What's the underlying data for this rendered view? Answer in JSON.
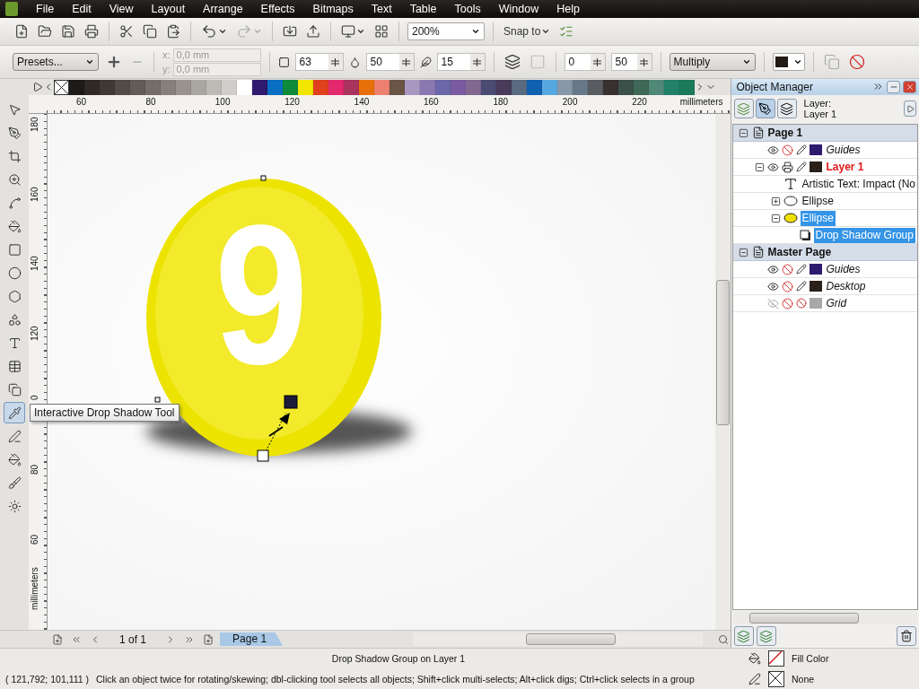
{
  "menu": [
    {
      "label": "File"
    },
    {
      "label": "Edit"
    },
    {
      "label": "View"
    },
    {
      "label": "Layout"
    },
    {
      "label": "Arrange"
    },
    {
      "label": "Effects"
    },
    {
      "label": "Bitmaps"
    },
    {
      "label": "Text"
    },
    {
      "label": "Table"
    },
    {
      "label": "Tools"
    },
    {
      "label": "Window"
    },
    {
      "label": "Help"
    }
  ],
  "toolbar": {
    "zoom": "200%",
    "snap": "Snap to"
  },
  "property_bar": {
    "presets": "Presets...",
    "x_label": "x:",
    "x_value": "0,0 mm",
    "y_label": "y:",
    "y_value": "0,0 mm",
    "opacity": "63",
    "feathering": "50",
    "feather_direction": "15",
    "fade": "0",
    "stretch": "50",
    "merge_mode": "Multiply"
  },
  "palette": [
    {
      "color": "#1e1a17"
    },
    {
      "color": "#2f2a26"
    },
    {
      "color": "#3f3935"
    },
    {
      "color": "#524b47"
    },
    {
      "color": "#625b57"
    },
    {
      "color": "#746e6a"
    },
    {
      "color": "#86807c"
    },
    {
      "color": "#98938f"
    },
    {
      "color": "#aaa6a2"
    },
    {
      "color": "#bdb9b5"
    },
    {
      "color": "#d0cdca"
    },
    {
      "color": "#ffffff"
    },
    {
      "color": "#2e1a6e"
    },
    {
      "color": "#0a6fc2"
    },
    {
      "color": "#0e8a3a"
    },
    {
      "color": "#f2e600"
    },
    {
      "color": "#e0401c"
    },
    {
      "color": "#e4286e"
    },
    {
      "color": "#a8335c"
    },
    {
      "color": "#e8700a"
    },
    {
      "color": "#ee8070"
    },
    {
      "color": "#6a5446"
    },
    {
      "color": "#a898c0"
    },
    {
      "color": "#8a78b0"
    },
    {
      "color": "#6a68a8"
    },
    {
      "color": "#7a5aa0"
    },
    {
      "color": "#806890"
    },
    {
      "color": "#4a4a72"
    },
    {
      "color": "#4a3a5a"
    },
    {
      "color": "#5a6a80"
    },
    {
      "color": "#1060b0"
    },
    {
      "color": "#58a8e0"
    },
    {
      "color": "#8898a8"
    },
    {
      "color": "#687888"
    },
    {
      "color": "#585c60"
    },
    {
      "color": "#383030"
    },
    {
      "color": "#3a5048"
    },
    {
      "color": "#406858"
    },
    {
      "color": "#508878"
    },
    {
      "color": "#208068"
    },
    {
      "color": "#1a7a5a"
    }
  ],
  "tools": [
    {
      "selected": false
    },
    {
      "selected": false
    },
    {
      "selected": false
    },
    {
      "selected": false
    },
    {
      "selected": false
    },
    {
      "selected": false
    },
    {
      "selected": false
    },
    {
      "selected": false
    },
    {
      "selected": false
    },
    {
      "selected": false
    },
    {
      "selected": false
    },
    {
      "selected": false
    },
    {
      "selected": false
    },
    {
      "selected": true
    },
    {
      "selected": false
    },
    {
      "selected": false
    },
    {
      "selected": false
    },
    {
      "selected": false
    }
  ],
  "tooltip": "Interactive Drop Shadow Tool",
  "ruler_top": {
    "labels": [
      "60",
      "80",
      "100",
      "120",
      "140",
      "160",
      "180",
      "200",
      "220"
    ],
    "unit": "millimeters"
  },
  "ruler_left": {
    "labels": [
      "180",
      "160",
      "140",
      "120",
      "0",
      "80",
      "60"
    ],
    "unit": "millimeters"
  },
  "canvas": {
    "digit": "9"
  },
  "page_nav": {
    "count": "1 of 1",
    "tab": "Page 1"
  },
  "object_manager": {
    "title": "Object Manager",
    "layer_label": "Layer:",
    "layer_name": "Layer 1",
    "tree": [
      {
        "kind": "page",
        "name": "Page 1",
        "expanded": true,
        "selected": false,
        "children": [
          {
            "kind": "layer",
            "name": "Guides",
            "special": true,
            "active": false,
            "visible": true,
            "printable": false,
            "editable": true,
            "color": "#2e1a6e",
            "selected": false
          },
          {
            "kind": "layer",
            "name": "Layer 1",
            "special": false,
            "active": true,
            "visible": true,
            "printable": true,
            "editable": true,
            "color": "#2a2018",
            "expanded": true,
            "selected": false,
            "children": [
              {
                "kind": "text",
                "name": "Artistic Text: Impact (No",
                "selected": false
              },
              {
                "kind": "ellipse",
                "name": "Ellipse",
                "filled": false,
                "expanded": false,
                "selected": false
              },
              {
                "kind": "ellipse",
                "name": "Ellipse",
                "filled": true,
                "expanded": true,
                "selected": true,
                "children": [
                  {
                    "kind": "shadow",
                    "name": "Drop Shadow Group",
                    "selected": true
                  }
                ]
              }
            ]
          }
        ]
      },
      {
        "kind": "page",
        "name": "Master Page",
        "expanded": true,
        "selected": false,
        "children": [
          {
            "kind": "layer",
            "name": "Guides",
            "special": true,
            "active": false,
            "visible": true,
            "printable": false,
            "editable": true,
            "color": "#2e1a6e",
            "selected": false
          },
          {
            "kind": "layer",
            "name": "Desktop",
            "special": true,
            "active": false,
            "visible": true,
            "printable": false,
            "editable": true,
            "color": "#2a2018",
            "selected": false
          },
          {
            "kind": "layer",
            "name": "Grid",
            "special": true,
            "active": false,
            "visible": false,
            "printable": false,
            "editable": false,
            "color": "#a8a8a8",
            "selected": false
          }
        ]
      }
    ]
  },
  "status": {
    "selection": "Drop Shadow Group on Layer 1",
    "coordinates": "( 121,792; 101,111 )",
    "hint": "Click an object twice for rotating/skewing; dbl-clicking tool selects all objects; Shift+click multi-selects; Alt+click digs; Ctrl+click selects in a group",
    "fill": "Fill Color",
    "outline": "None"
  }
}
